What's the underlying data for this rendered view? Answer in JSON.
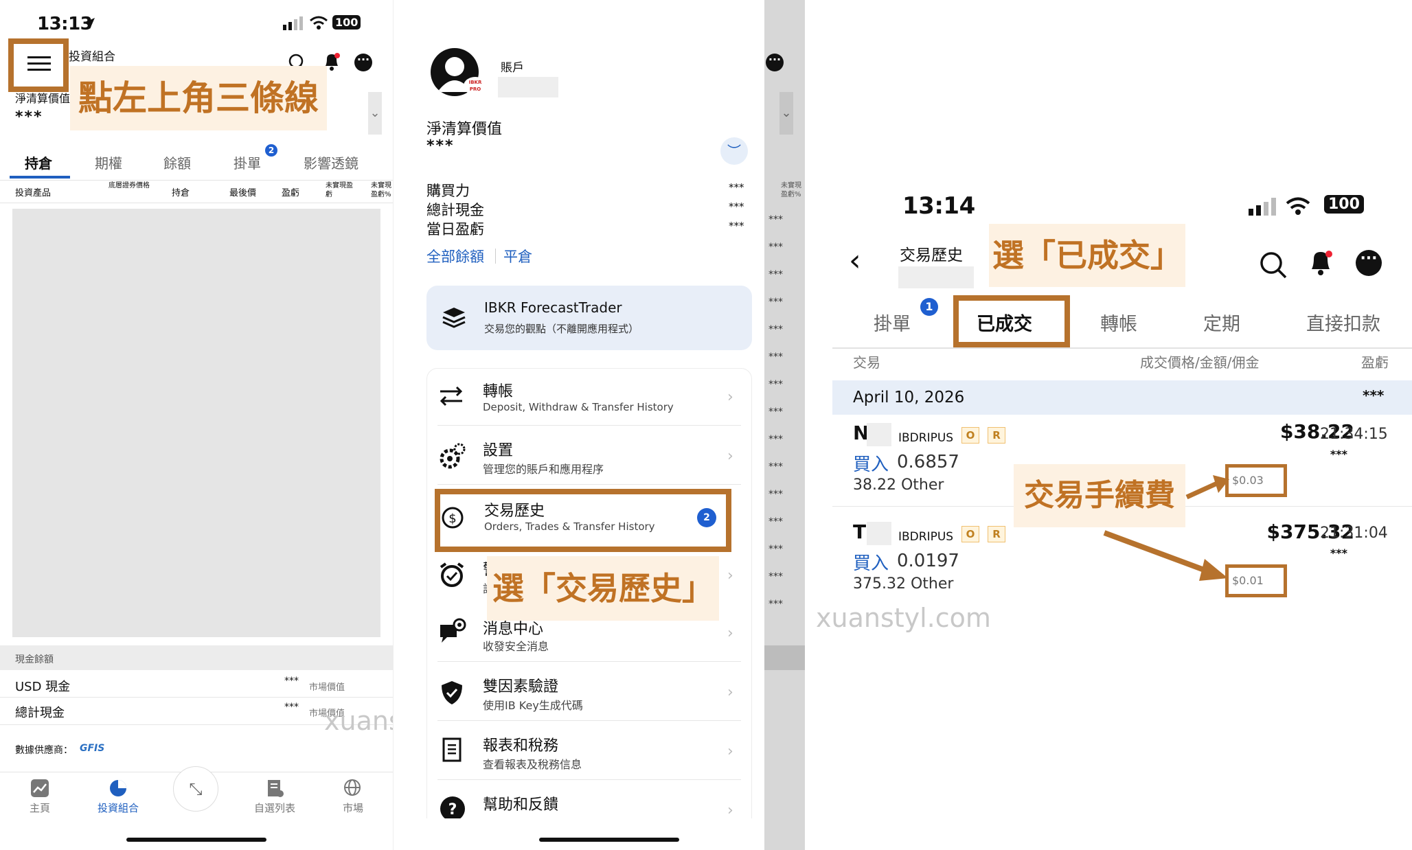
{
  "panel1": {
    "time": "13:13",
    "battery": "100",
    "app_title": "投資組合",
    "nlv_label": "淨清算價值",
    "nlv_value": "***",
    "callout": "點左上角三條線",
    "tabs": [
      "持倉",
      "期權",
      "餘額",
      "掛單",
      "影響透鏡"
    ],
    "orders_badge": "2",
    "columns": [
      "投資產品",
      "底層證券價格",
      "持倉",
      "最後價",
      "盈虧",
      "未實現盈虧",
      "未實現盈虧%"
    ],
    "cash_section": "現金餘額",
    "cash_rows": [
      {
        "label": "USD 現金",
        "value": "***",
        "type": "市場價值"
      },
      {
        "label": "總計現金",
        "value": "***",
        "type": "市場價值"
      }
    ],
    "data_provider_label": "數據供應商：",
    "data_provider": "GFIS",
    "nav": [
      "主頁",
      "投資組合",
      "",
      "自選列表",
      "市場"
    ],
    "watermark": "xuanstyl.com"
  },
  "panel2": {
    "account_label": "賬戶",
    "avatar_tag": "IBKR PRO",
    "nlv_label": "淨清算價值",
    "nlv_value": "***",
    "stats": [
      {
        "label": "購買力",
        "value": "***"
      },
      {
        "label": "總計現金",
        "value": "***"
      },
      {
        "label": "當日盈虧",
        "value": "***"
      }
    ],
    "link_all": "全部餘額",
    "link_close": "平倉",
    "forecast_title": "IBKR ForecastTrader",
    "forecast_sub": "交易您的觀點（不離開應用程式）",
    "menu": [
      {
        "title": "轉帳",
        "sub": "Deposit, Withdraw & Transfer History",
        "icon": "transfer-icon"
      },
      {
        "title": "設置",
        "sub": "管理您的賬戶和應用程序",
        "icon": "gear-icon"
      },
      {
        "title": "交易歷史",
        "sub": "Orders, Trades & Transfer History",
        "icon": "trade-history-icon",
        "badge": "2"
      },
      {
        "title": "警",
        "sub": "設",
        "icon": "alarm-icon"
      },
      {
        "title": "消息中心",
        "sub": "收發安全消息",
        "icon": "message-icon"
      },
      {
        "title": "雙因素驗證",
        "sub": "使用IB Key生成代碼",
        "icon": "shield-icon"
      },
      {
        "title": "報表和稅務",
        "sub": "查看報表及稅務信息",
        "icon": "report-icon"
      },
      {
        "title": "幫助和反饋",
        "sub": "",
        "icon": "help-icon"
      }
    ],
    "callout": "選「交易歷史」",
    "stars_column": [
      "***",
      "***",
      "***",
      "***",
      "***",
      "***",
      "***",
      "***",
      "***",
      "***",
      "***",
      "***",
      "***",
      "***",
      "***"
    ],
    "right_cols": [
      "未實現盈虧%"
    ]
  },
  "panel3": {
    "time": "13:14",
    "battery": "100",
    "title": "交易歷史",
    "callout_tab": "選「已成交」",
    "tabs": [
      "掛單",
      "已成交",
      "轉帳",
      "定期",
      "直接扣款"
    ],
    "orders_badge": "1",
    "col_trade": "交易",
    "col_price": "成交價格/金額/佣金",
    "col_pnl": "盈虧",
    "date": "April 10, 2026",
    "date_value": "***",
    "trades": [
      {
        "symbol": "N",
        "exchange": "IBDRIPUS",
        "tag1": "O",
        "tag2": "R",
        "side": "買入",
        "qty": "0.6857",
        "sub": "38.22 Other",
        "price": "$38.22",
        "stars": "***",
        "fee": "$0.03",
        "time": "21:34:15"
      },
      {
        "symbol": "T:",
        "exchange": "IBDRIPUS",
        "tag1": "O",
        "tag2": "R",
        "side": "買入",
        "qty": "0.0197",
        "sub": "375.32 Other",
        "price": "$375.32",
        "stars": "***",
        "fee": "$0.01",
        "time": "21:31:04"
      }
    ],
    "callout_fee": "交易手續費",
    "watermark": "xuanstyl.com"
  },
  "colors": {
    "accent": "#b6722d",
    "blue": "#1f5fbf",
    "callout_bg": "#fdf1e2"
  }
}
